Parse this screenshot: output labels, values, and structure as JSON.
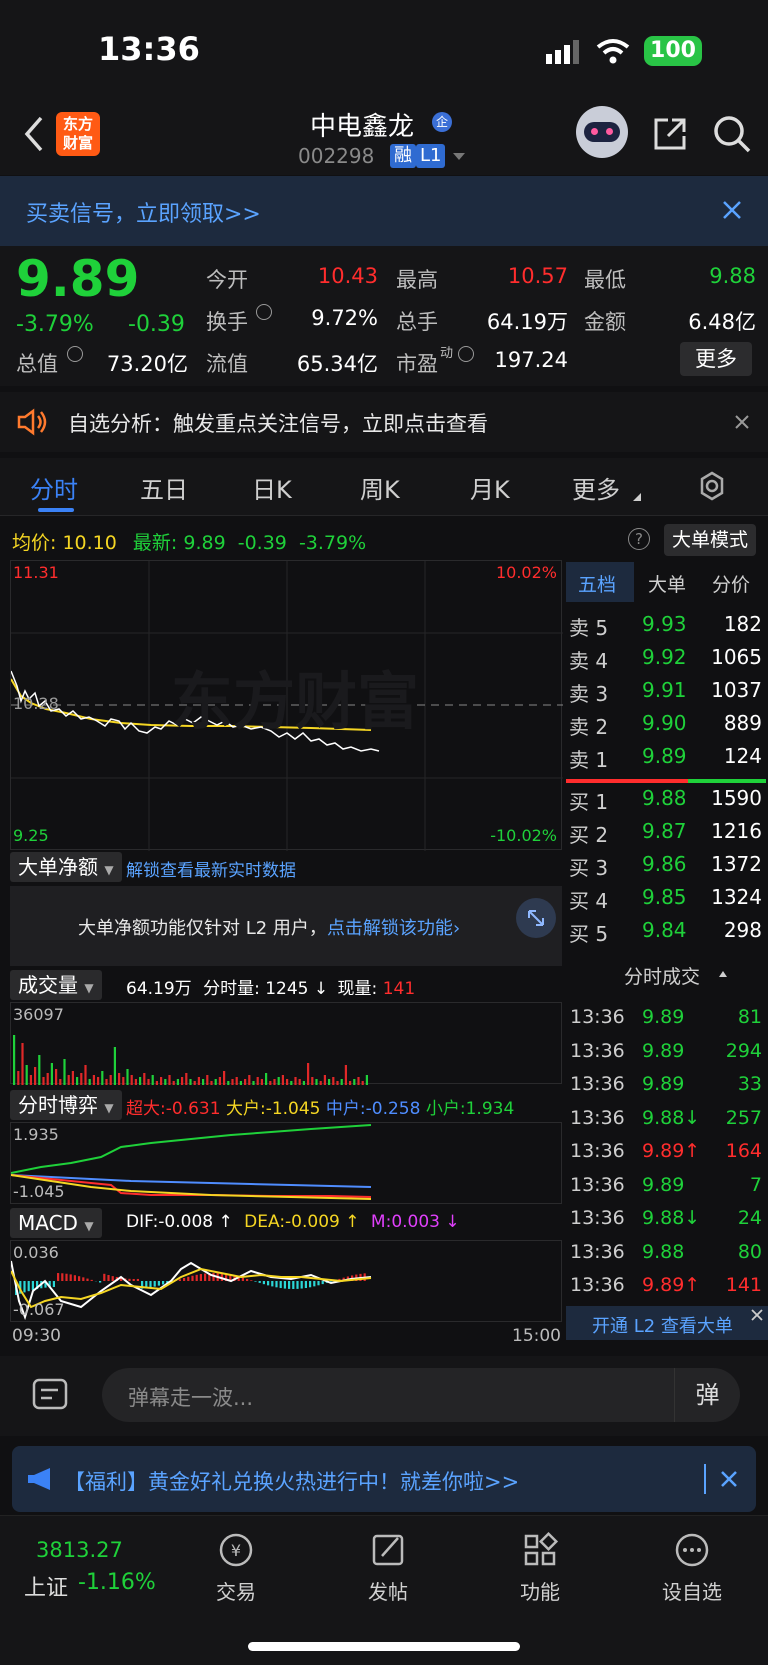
{
  "status": {
    "time": "13:36",
    "battery": "100"
  },
  "header": {
    "logo_line1": "东方",
    "logo_line2": "财富",
    "stock_name": "中电鑫龙",
    "stock_code": "002298",
    "tag_rong": "融",
    "tag_level": "L1"
  },
  "banner": {
    "text": "买卖信号，立即领取>>"
  },
  "quote": {
    "price": "9.89",
    "change_pct": "-3.79%",
    "change_abs": "-0.39",
    "open_label": "今开",
    "open": "10.43",
    "high_label": "最高",
    "high": "10.57",
    "low_label": "最低",
    "low": "9.88",
    "turnover_label": "换手",
    "turnover": "9.72%",
    "volume_label": "总手",
    "volume": "64.19万",
    "amount_label": "金额",
    "amount": "6.48亿",
    "mcap_label": "总值",
    "mcap": "73.20亿",
    "float_label": "流值",
    "float": "65.34亿",
    "pe_label": "市盈",
    "pe_sup": "动",
    "pe": "197.24",
    "more_label": "更多"
  },
  "analysis": {
    "text": "自选分析：触发重点关注信号，立即点击查看"
  },
  "tabs": [
    "分时",
    "五日",
    "日K",
    "周K",
    "月K",
    "更多"
  ],
  "chart_head": {
    "avg_label": "均价:",
    "avg": "10.10",
    "latest_label": "最新:",
    "latest": "9.89",
    "latest_chg": "-0.39",
    "latest_pct": "-3.79%",
    "big_mode": "大单模式"
  },
  "chart": {
    "top_price": "11.31",
    "bottom_price": "9.25",
    "top_pct": "10.02%",
    "bottom_pct": "-10.02%",
    "ref_price": "10.28",
    "watermark": "东方财富"
  },
  "net_panel": {
    "title": "大单净额",
    "unlock_link": "解锁查看最新实时数据",
    "notice": "大单净额功能仅针对 L2 用户，",
    "notice_link": "点击解锁该功能"
  },
  "volume_panel": {
    "title": "成交量",
    "total": "64.19万",
    "minute_label": "分时量:",
    "minute_val": "1245",
    "cur_label": "现量:",
    "cur_val": "141",
    "max": "36097"
  },
  "game_panel": {
    "title": "分时博弈",
    "super_label": "超大:",
    "super_val": "-0.631",
    "big_label": "大户:",
    "big_val": "-1.045",
    "mid_label": "中户:",
    "mid_val": "-0.258",
    "small_label": "小户:",
    "small_val": "1.934",
    "top": "1.935",
    "bottom": "-1.045"
  },
  "macd_panel": {
    "title": "MACD",
    "dif_label": "DIF:",
    "dif_val": "-0.008 ↑",
    "dea_label": "DEA:",
    "dea_val": "-0.009 ↑",
    "m_label": "M:",
    "m_val": "0.003 ↓",
    "top": "0.036",
    "bottom": "-0.067"
  },
  "time_axis": {
    "start": "09:30",
    "end": "15:00"
  },
  "book": {
    "tabs": [
      "五档",
      "大单",
      "分价"
    ],
    "asks": [
      {
        "label": "卖 5",
        "price": "9.93",
        "vol": "182"
      },
      {
        "label": "卖 4",
        "price": "9.92",
        "vol": "1065"
      },
      {
        "label": "卖 3",
        "price": "9.91",
        "vol": "1037"
      },
      {
        "label": "卖 2",
        "price": "9.90",
        "vol": "889"
      },
      {
        "label": "卖 1",
        "price": "9.89",
        "vol": "124"
      }
    ],
    "bids": [
      {
        "label": "买 1",
        "price": "9.88",
        "vol": "1590"
      },
      {
        "label": "买 2",
        "price": "9.87",
        "vol": "1216"
      },
      {
        "label": "买 3",
        "price": "9.86",
        "vol": "1372"
      },
      {
        "label": "买 4",
        "price": "9.85",
        "vol": "1324"
      },
      {
        "label": "买 5",
        "price": "9.84",
        "vol": "298"
      }
    ],
    "trades_title": "分时成交",
    "trades": [
      {
        "time": "13:36",
        "price": "9.89",
        "vol": "81",
        "color": "#1fd13a"
      },
      {
        "time": "13:36",
        "price": "9.89",
        "vol": "294",
        "color": "#1fd13a"
      },
      {
        "time": "13:36",
        "price": "9.89",
        "vol": "33",
        "color": "#1fd13a"
      },
      {
        "time": "13:36",
        "price": "9.88↓",
        "vol": "257",
        "color": "#1fd13a"
      },
      {
        "time": "13:36",
        "price": "9.89↑",
        "vol": "164",
        "color": "#ff2d2d"
      },
      {
        "time": "13:36",
        "price": "9.89",
        "vol": "7",
        "color": "#1fd13a"
      },
      {
        "time": "13:36",
        "price": "9.88↓",
        "vol": "24",
        "color": "#1fd13a"
      },
      {
        "time": "13:36",
        "price": "9.88",
        "vol": "80",
        "color": "#1fd13a"
      },
      {
        "time": "13:36",
        "price": "9.89↑",
        "vol": "141",
        "color": "#ff2d2d"
      }
    ],
    "open_l2": "开通 L2 查看大单"
  },
  "comment": {
    "placeholder": "弹幕走一波...",
    "send": "弹"
  },
  "welfare": {
    "text": "【福利】黄金好礼兑换火热进行中！就差你啦>>"
  },
  "tabbar": {
    "index_value": "3813.27",
    "index_name": "上证",
    "index_chg": "-1.16%",
    "trade": "交易",
    "post": "发帖",
    "function": "功能",
    "watch": "设自选"
  }
}
